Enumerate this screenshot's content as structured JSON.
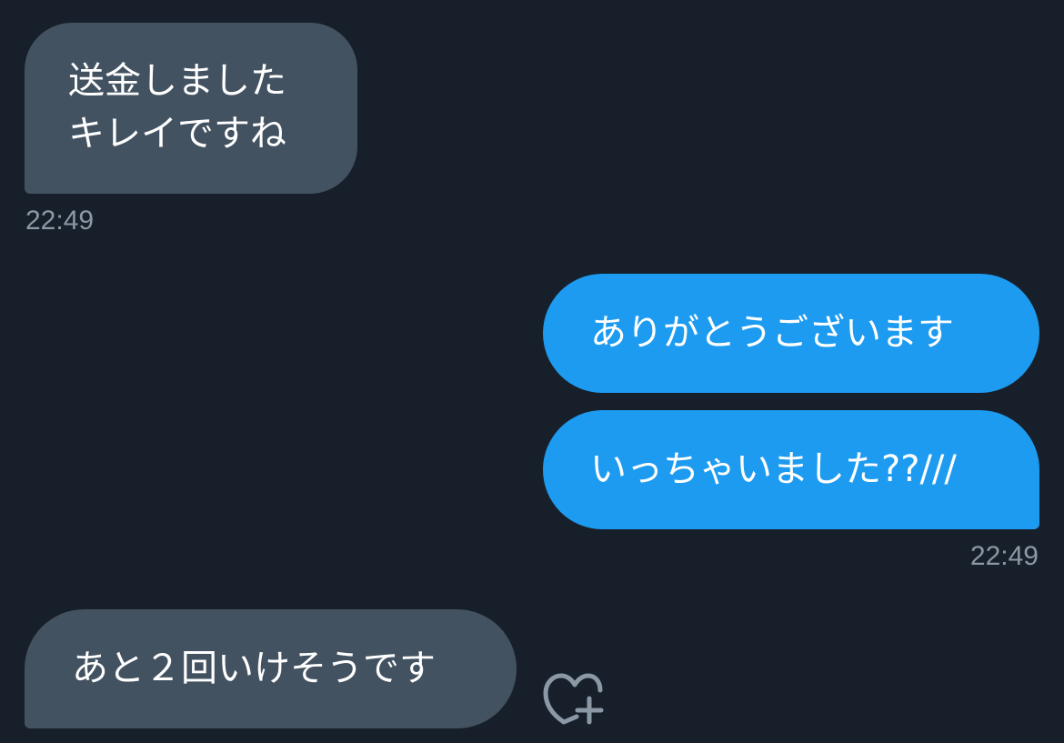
{
  "messages": [
    {
      "direction": "received",
      "text": "送金しました\nキレイですね",
      "timestamp": "22:49"
    },
    {
      "direction": "sent",
      "text": "ありがとうございます"
    },
    {
      "direction": "sent",
      "text": "いっちゃいました??///",
      "timestamp": "22:49"
    },
    {
      "direction": "received",
      "text": "あと２回いけそうです"
    }
  ],
  "reaction_icon": "heart-plus-icon",
  "colors": {
    "background": "#17202a",
    "received_bubble": "#435261",
    "sent_bubble": "#1d9bf0",
    "text": "#ffffff",
    "timestamp": "#8b98a5",
    "icon": "#8b98a5"
  }
}
